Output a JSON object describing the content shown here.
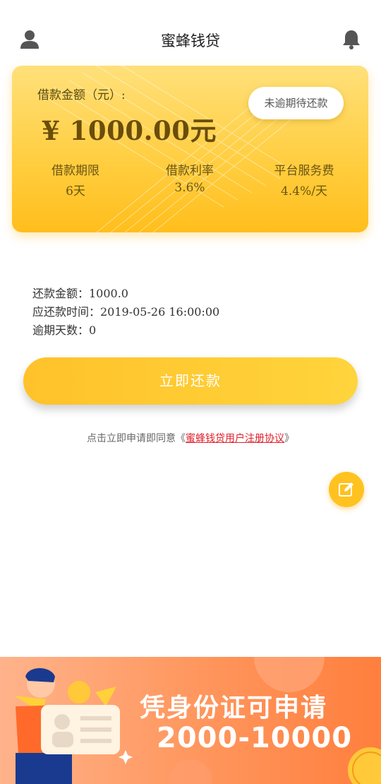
{
  "header": {
    "title": "蜜蜂钱贷",
    "left_icon": "user-icon",
    "right_icon": "bell-icon"
  },
  "loan_card": {
    "amount_label": "借款金额（元）:",
    "amount": "¥ 1000.00元",
    "status": "未逾期待还款",
    "stats": [
      {
        "label": "借款期限",
        "value": "6天"
      },
      {
        "label": "借款利率",
        "value": "3.6%"
      },
      {
        "label": "平台服务费",
        "value": "4.4%/天"
      }
    ]
  },
  "repayment": {
    "amount_line": "还款金额：1000.0",
    "due_line": "应还款时间：2019-05-26 16:00:00",
    "overdue_line": "逾期天数：0"
  },
  "actions": {
    "repay_button": "立即还款",
    "agreement_prefix": "点击立即申请即同意《",
    "agreement_link": "蜜蜂钱贷用户注册协议",
    "agreement_suffix": "》",
    "fab_icon": "edit-icon"
  },
  "banner": {
    "line1": "凭身份证可申请",
    "line2": "2000-10000"
  },
  "colors": {
    "accent": "#ffc21f",
    "card_top": "#ffe07a",
    "card_bottom": "#ffbe1c",
    "link": "#e0202a",
    "banner": "#ff8a4a"
  }
}
